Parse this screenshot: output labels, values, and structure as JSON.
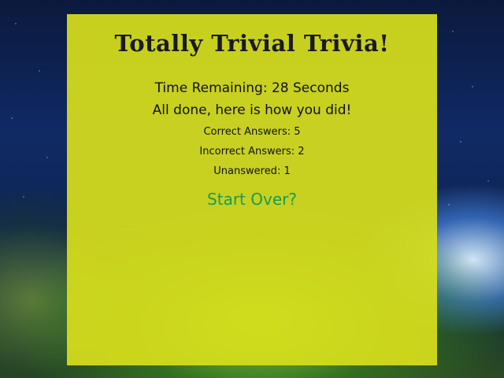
{
  "app": {
    "title": "Totally Trivial Trivia!"
  },
  "results": {
    "time_remaining": "Time Remaining: 28 Seconds",
    "message": "All done, here is how you did!",
    "correct": "Correct Answers: 5",
    "incorrect": "Incorrect Answers: 2",
    "unanswered": "Unanswered: 1"
  },
  "actions": {
    "start_over_label": "Start Over?"
  },
  "colors": {
    "panel": "#d6de1c",
    "start_over": "#1d9a4c",
    "title": "#1a1a1a"
  }
}
